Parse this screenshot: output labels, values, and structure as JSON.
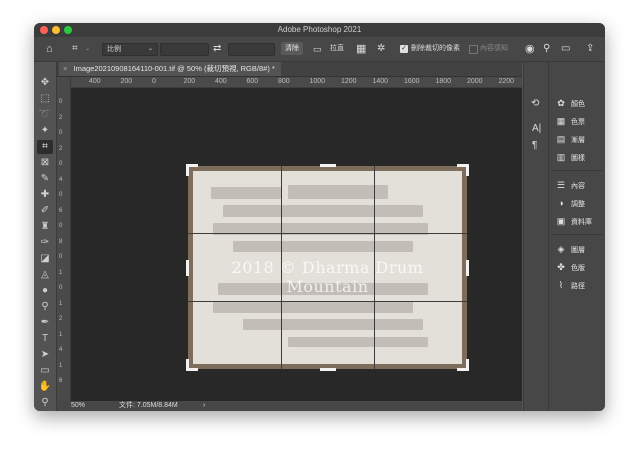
{
  "window": {
    "title": "Adobe Photoshop 2021"
  },
  "traffic_lights": [
    "#ff5f57",
    "#febc2e",
    "#28c840"
  ],
  "options_bar": {
    "ratio_label": "比例",
    "clear_label": "清除",
    "straighten_label": "拉直",
    "delete_cropped_label": "刪除裁切的像素",
    "content_aware_label": "內容感知",
    "delete_cropped_checked": true
  },
  "document_tab": {
    "close": "×",
    "title": "Image20210908164110-001.tif @ 50% (裁切預視, RGB/8#) *"
  },
  "ruler": {
    "horizontal": [
      "400",
      "200",
      "0",
      "200",
      "400",
      "600",
      "800",
      "1000",
      "1200",
      "1400",
      "1600",
      "1800",
      "2000",
      "2200"
    ],
    "vertical": [
      "0",
      "2",
      "0",
      "2",
      "0",
      "4",
      "0",
      "6",
      "0",
      "8",
      "0",
      "1",
      "0",
      "1",
      "2",
      "1",
      "4",
      "1",
      "6"
    ]
  },
  "watermark": "2018 © Dharma Drum Mountain",
  "status_bar": {
    "zoom": "50%",
    "file_info": "文件: 7.05M/8.84M",
    "arrow": "›"
  },
  "panels": {
    "group1": [
      {
        "icon": "palette-icon",
        "glyph": "✿",
        "label": "顏色"
      },
      {
        "icon": "swatches-icon",
        "glyph": "▦",
        "label": "色票"
      },
      {
        "icon": "gradient-icon",
        "glyph": "▤",
        "label": "漸層"
      },
      {
        "icon": "patterns-icon",
        "glyph": "▥",
        "label": "圖樣"
      }
    ],
    "group2": [
      {
        "icon": "properties-icon",
        "glyph": "☰",
        "label": "內容"
      },
      {
        "icon": "adjustments-icon",
        "glyph": "◑",
        "label": "調整"
      },
      {
        "icon": "libraries-icon",
        "glyph": "▣",
        "label": "資料庫"
      }
    ],
    "group3": [
      {
        "icon": "layers-icon",
        "glyph": "◈",
        "label": "圖層"
      },
      {
        "icon": "channels-icon",
        "glyph": "✤",
        "label": "色版"
      },
      {
        "icon": "paths-icon",
        "glyph": "⌇",
        "label": "路徑"
      }
    ]
  },
  "tools": [
    {
      "name": "move-tool-icon",
      "glyph": "✥"
    },
    {
      "name": "marquee-tool-icon",
      "glyph": "⬚"
    },
    {
      "name": "lasso-tool-icon",
      "glyph": "➰"
    },
    {
      "name": "magic-wand-tool-icon",
      "glyph": "✦"
    },
    {
      "name": "crop-tool-icon",
      "glyph": "⌗",
      "active": true
    },
    {
      "name": "frame-tool-icon",
      "glyph": "⊠"
    },
    {
      "name": "eyedropper-tool-icon",
      "glyph": "✎"
    },
    {
      "name": "healing-brush-tool-icon",
      "glyph": "✚"
    },
    {
      "name": "brush-tool-icon",
      "glyph": "✐"
    },
    {
      "name": "clone-stamp-tool-icon",
      "glyph": "♜"
    },
    {
      "name": "history-brush-tool-icon",
      "glyph": "✑"
    },
    {
      "name": "eraser-tool-icon",
      "glyph": "◪"
    },
    {
      "name": "paint-bucket-tool-icon",
      "glyph": "◬"
    },
    {
      "name": "blur-tool-icon",
      "glyph": "●"
    },
    {
      "name": "dodge-tool-icon",
      "glyph": "⚲"
    },
    {
      "name": "pen-tool-icon",
      "glyph": "✒"
    },
    {
      "name": "type-tool-icon",
      "glyph": "T"
    },
    {
      "name": "path-selection-tool-icon",
      "glyph": "➤"
    },
    {
      "name": "rectangle-tool-icon",
      "glyph": "▭"
    },
    {
      "name": "hand-tool-icon",
      "glyph": "✋"
    },
    {
      "name": "zoom-tool-icon",
      "glyph": "⚲"
    }
  ]
}
